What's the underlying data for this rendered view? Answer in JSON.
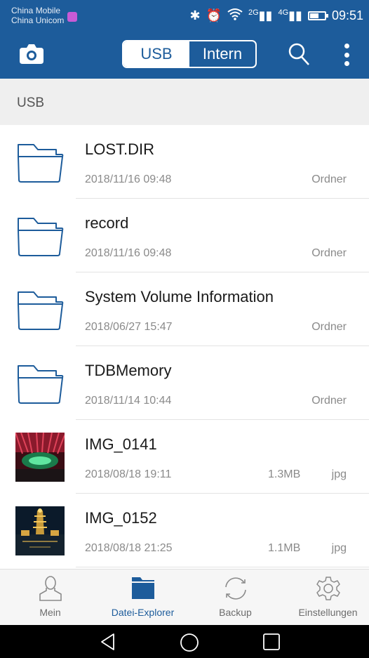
{
  "status_bar": {
    "carrier_1": "China Mobile",
    "carrier_2": "China Unicom",
    "network_2g": "2G",
    "network_4g": "4G",
    "time": "09:51"
  },
  "app_bar": {
    "tabs": [
      {
        "label": "USB",
        "active": true
      },
      {
        "label": "Intern",
        "active": false
      }
    ],
    "accent_color": "#1d5c9b"
  },
  "path_bar": {
    "label": "USB"
  },
  "files": [
    {
      "name": "LOST.DIR",
      "date": "2018/11/16 09:48",
      "size": "",
      "type": "Ordner",
      "icon": "folder-icon"
    },
    {
      "name": "record",
      "date": "2018/11/16 09:48",
      "size": "",
      "type": "Ordner",
      "icon": "folder-icon"
    },
    {
      "name": "System Volume Information",
      "date": "2018/06/27 15:47",
      "size": "",
      "type": "Ordner",
      "icon": "folder-icon"
    },
    {
      "name": "TDBMemory",
      "date": "2018/11/14 10:44",
      "size": "",
      "type": "Ordner",
      "icon": "folder-icon"
    },
    {
      "name": "IMG_0141",
      "date": "2018/08/18 19:11",
      "size": "1.3MB",
      "type": "jpg",
      "icon": "image-thumbnail"
    },
    {
      "name": "IMG_0152",
      "date": "2018/08/18 21:25",
      "size": "1.1MB",
      "type": "jpg",
      "icon": "image-thumbnail"
    }
  ],
  "bottom_nav": [
    {
      "label": "Mein",
      "icon": "person-icon",
      "active": false
    },
    {
      "label": "Datei-Explorer",
      "icon": "folder-icon",
      "active": true
    },
    {
      "label": "Backup",
      "icon": "sync-icon",
      "active": false
    },
    {
      "label": "Einstellungen",
      "icon": "gear-icon",
      "active": false
    }
  ]
}
